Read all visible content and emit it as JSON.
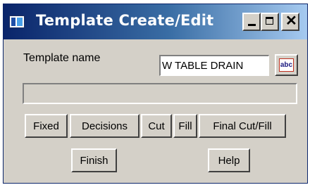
{
  "window": {
    "title": "Template Create/Edit",
    "controls": {
      "minimize": "minimize-icon",
      "maximize": "maximize-icon",
      "close": "close-icon"
    },
    "close_glyph": "✕"
  },
  "form": {
    "template_name_label": "Template name",
    "template_name_value": "W TABLE DRAIN",
    "abc_button_label": "abc",
    "message": ""
  },
  "buttons": {
    "fixed": "Fixed",
    "decisions": "Decisions",
    "cut": "Cut",
    "fill": "Fill",
    "final_cut_fill": "Final Cut/Fill",
    "finish": "Finish",
    "help": "Help"
  },
  "colors": {
    "titlebar_start": "#0a246a",
    "titlebar_end": "#a6caf0",
    "face": "#d4d0c8"
  }
}
